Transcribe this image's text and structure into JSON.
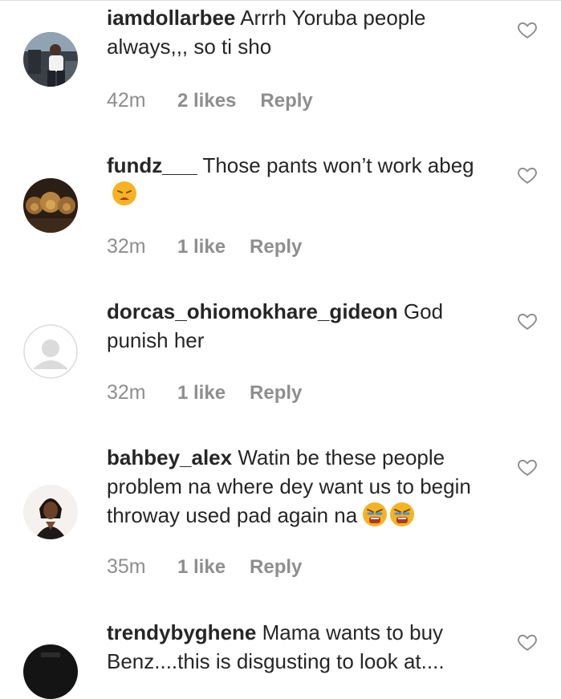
{
  "comments": [
    {
      "username": "iamdollarbee",
      "text": "Arrrh Yoruba people always,,, so ti sho",
      "time": "42m",
      "likes": "2 likes",
      "reply": "Reply"
    },
    {
      "username": "fundz___",
      "text": "Those pants won’t work abeg",
      "time": "32m",
      "likes": "1 like",
      "reply": "Reply"
    },
    {
      "username": "dorcas_ohiomokhare_gideon",
      "text": "God punish her",
      "time": "32m",
      "likes": "1 like",
      "reply": "Reply"
    },
    {
      "username": "bahbey_alex",
      "text": "Watin be these people problem na where dey want us to begin throway used pad again na",
      "time": "35m",
      "likes": "1 like",
      "reply": "Reply"
    },
    {
      "username": "trendybyghene",
      "text": "Mama wants to buy Benz....this is disgusting to look at....",
      "time": "",
      "likes": "",
      "reply": ""
    }
  ],
  "icons": {
    "like": "heart-outline-icon",
    "emoji_tired": "tired-face-emoji",
    "emoji_angry": "loudly-angry-face-emoji"
  },
  "colors": {
    "text": "#262626",
    "meta": "#8e8e8e",
    "heart": "#8e8e8e",
    "emoji": "#f5b324"
  }
}
